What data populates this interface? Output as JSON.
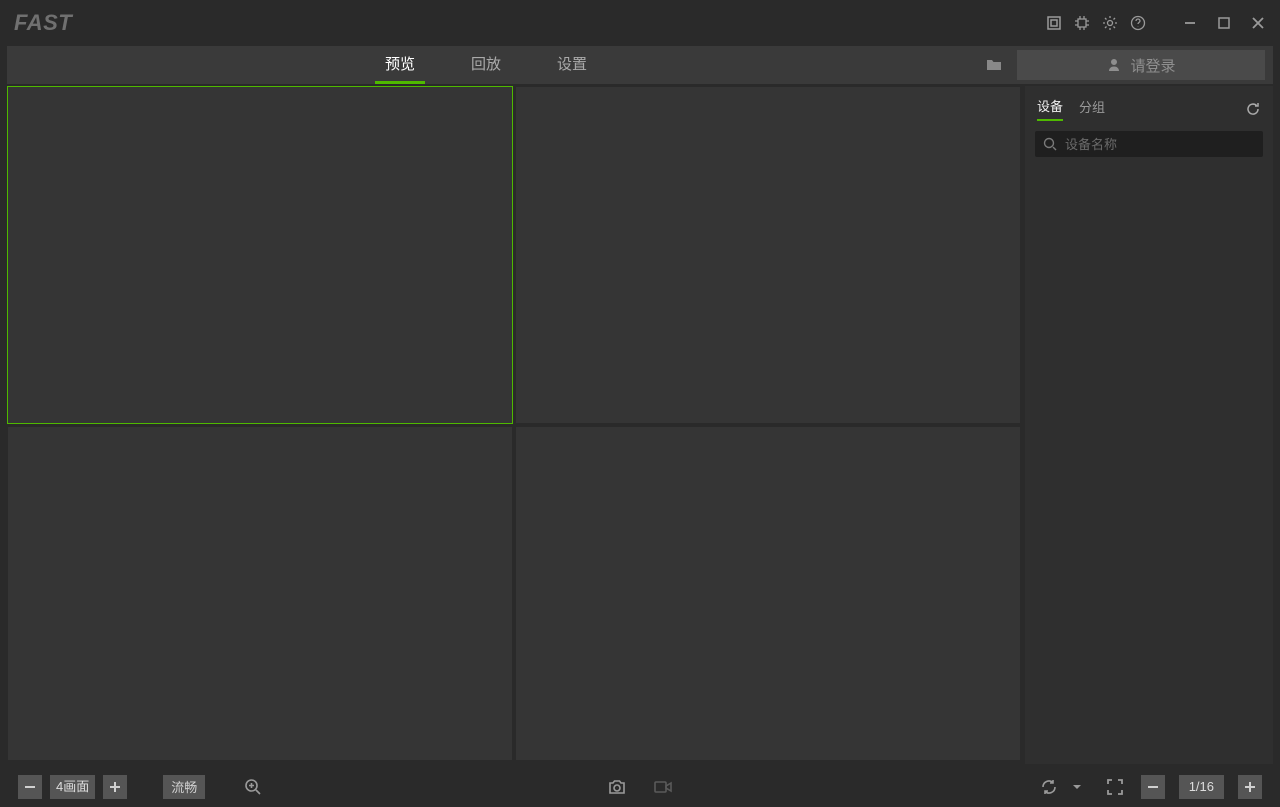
{
  "app": {
    "logo_text": "FAST"
  },
  "nav": {
    "tabs": [
      {
        "label": "预览",
        "active": true
      },
      {
        "label": "回放",
        "active": false
      },
      {
        "label": "设置",
        "active": false
      }
    ],
    "login_label": "请登录"
  },
  "sidebar": {
    "tabs": [
      {
        "label": "设备",
        "active": true
      },
      {
        "label": "分组",
        "active": false
      }
    ],
    "search_placeholder": "设备名称"
  },
  "footer": {
    "layout_label": "4画面",
    "stream_label": "流畅",
    "page_display": "1/16"
  },
  "grid": {
    "cols": 2,
    "rows": 2,
    "selected": 0
  }
}
